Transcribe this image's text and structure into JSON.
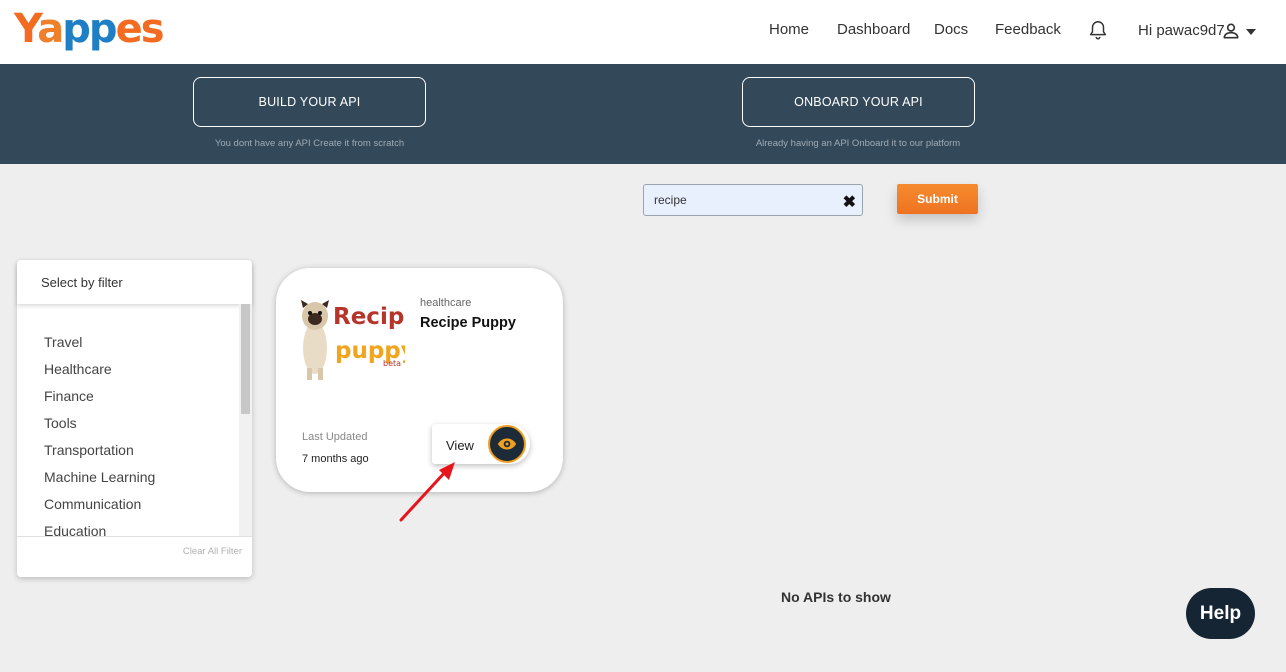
{
  "header": {
    "logo_parts": {
      "y": "Y",
      "a": "a",
      "pp": "pp",
      "es": "es"
    },
    "nav": [
      "Home",
      "Dashboard",
      "Docs",
      "Feedback"
    ],
    "greeting": "Hi pawac9d7",
    "icons": {
      "bell": "bell-icon",
      "user": "user-icon",
      "caret": "chevron-down-icon"
    }
  },
  "banner": {
    "build_label": "BUILD YOUR API",
    "build_sub": "You dont have any API Create it from scratch",
    "onboard_label": "ONBOARD YOUR API",
    "onboard_sub": "Already having an API Onboard it to our platform"
  },
  "search": {
    "value": "recipe",
    "clear_glyph": "✖",
    "submit_label": "Submit"
  },
  "filter": {
    "title": "Select by filter",
    "items": [
      "Travel",
      "Healthcare",
      "Finance",
      "Tools",
      "Transportation",
      "Machine Learning",
      "Communication",
      "Education"
    ],
    "clear_all": "Clear All Filter"
  },
  "card": {
    "image_text_1": "Recipe",
    "image_text_2": "puppy",
    "image_text_3": "beta",
    "category": "healthcare",
    "title": "Recipe Puppy",
    "last_updated_label": "Last Updated",
    "last_updated_value": "7 months ago",
    "view_label": "View"
  },
  "results": {
    "empty_text": "No APIs to show"
  },
  "help": {
    "label": "Help"
  },
  "colors": {
    "accent": "#f26b21",
    "banner": "#33495a",
    "help_bg": "#162534",
    "arrow": "#e8141c"
  }
}
